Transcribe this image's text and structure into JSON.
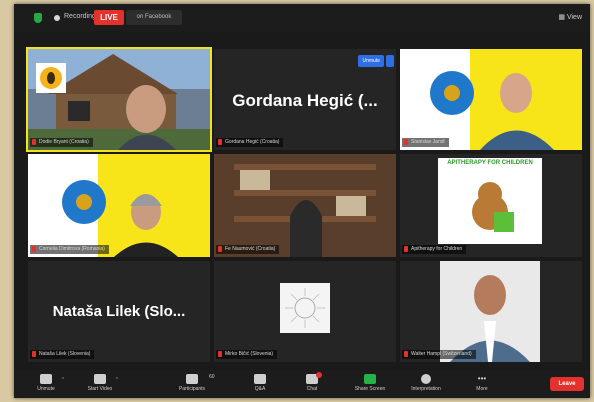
{
  "topbar": {
    "recording_label": "Recording",
    "live_label": "LIVE",
    "facebook_label": "on Facebook",
    "view_label": "View"
  },
  "tiles": [
    {
      "name": "Dodie Bryant (Croatia)"
    },
    {
      "name": "Gordana Hegić (Croatia)",
      "big_name": "Gordana Hegić (...",
      "unmute": "Unmute"
    },
    {
      "name": "Stanislav Jandl"
    },
    {
      "name": "Cornelia Dimitrova (Romania)"
    },
    {
      "name": "Fe Naumović (Croatia)"
    },
    {
      "name": "Apitherapy for Children",
      "logo_text": "APITHERAPY FOR CHILDREN"
    },
    {
      "name": "Nataša Lilek (Slovenia)",
      "big_name": "Nataša Lilek (Slo..."
    },
    {
      "name": "Mirko Bičić (Slovenia)"
    },
    {
      "name": "Walter Hampl (Switzerland)"
    }
  ],
  "toolbar": {
    "unmute": "Unmute",
    "start_video": "Start Video",
    "participants": "Participants",
    "participants_count": "60",
    "qa": "Q&A",
    "chat": "Chat",
    "share_screen": "Share Screen",
    "interpretation": "Interpretation",
    "more": "More",
    "leave": "Leave"
  },
  "colors": {
    "live": "#e5312b",
    "active_speaker": "#f2e31c",
    "share_green": "#26b24b",
    "logo_yellow": "#f7e51a"
  }
}
